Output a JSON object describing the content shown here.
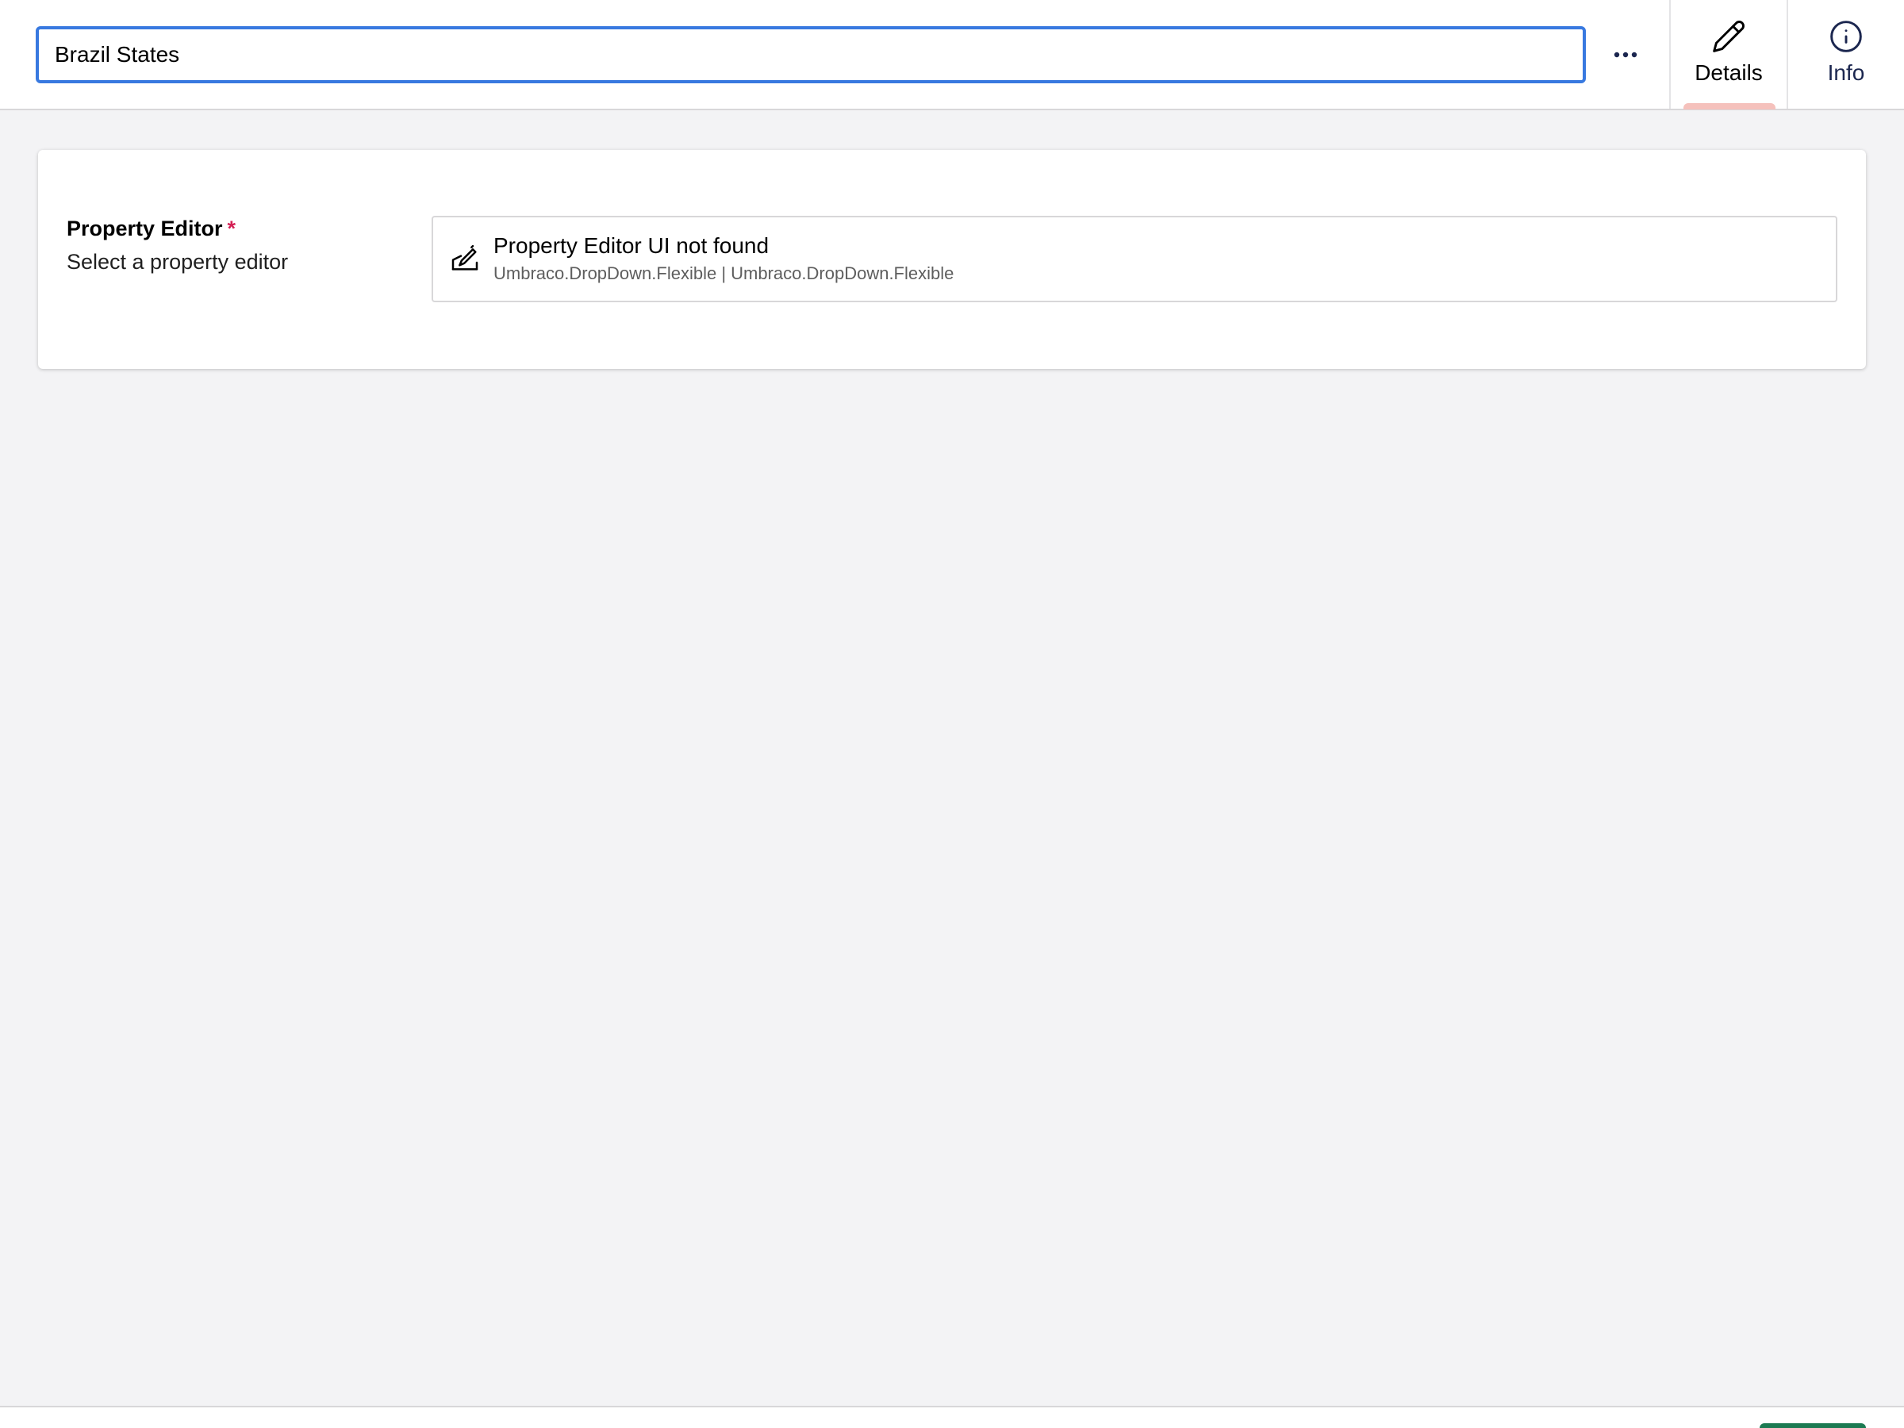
{
  "header": {
    "name_input": {
      "value": "Brazil States"
    },
    "more_button": {
      "label": "···"
    },
    "tabs": [
      {
        "label": "Details",
        "icon": "pencil-icon",
        "active": true
      },
      {
        "label": "Info",
        "icon": "info-icon",
        "active": false
      }
    ]
  },
  "property": {
    "label": "Property Editor",
    "required_mark": "*",
    "description": "Select a property editor",
    "editor": {
      "icon": "edit-document-icon",
      "title": "Property Editor UI not found",
      "alias": "Umbraco.DropDown.Flexible | Umbraco.DropDown.Flexible"
    }
  },
  "colors": {
    "focus_border": "#3879e0",
    "active_tab_indicator": "#f5c1bc",
    "required": "#d42054",
    "save_button": "#1c7a52"
  }
}
